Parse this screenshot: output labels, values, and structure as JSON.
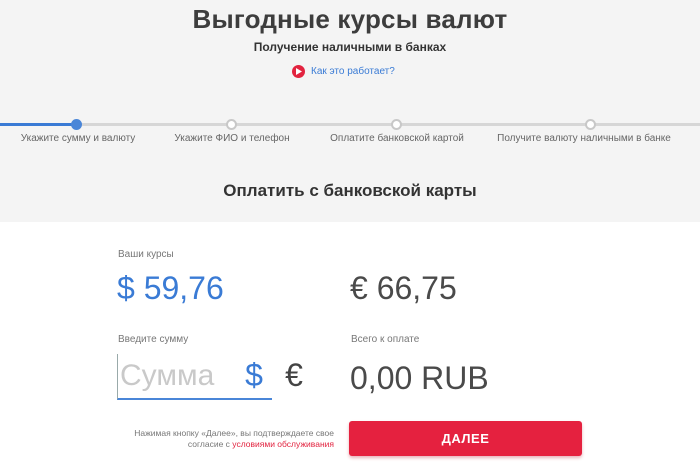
{
  "header": {
    "title": "Выгодные курсы валют",
    "subtitle": "Получение наличными в банках",
    "how_it_works": "Как это работает?"
  },
  "steps": [
    {
      "label": "Укажите сумму и валюту",
      "active": true
    },
    {
      "label": "Укажите ФИО и телефон",
      "active": false
    },
    {
      "label": "Оплатите банковской картой",
      "active": false
    },
    {
      "label": "Получите валюту наличными в банке",
      "active": false
    }
  ],
  "section_title": "Оплатить с банковской карты",
  "rates": {
    "label": "Ваши курсы",
    "usd": "$ 59,76",
    "eur": "€ 66,75"
  },
  "amount": {
    "label": "Введите сумму",
    "placeholder": "Сумма",
    "value": "",
    "currencies": [
      "$",
      "€"
    ],
    "selected_currency": "$"
  },
  "total": {
    "label": "Всего к оплате",
    "value": "0,00 RUB"
  },
  "consent": {
    "text": "Нажимая кнопку «Далее», вы подтверждаете свое согласие с",
    "link": "условиями обслуживания"
  },
  "next_button": "ДАЛЕЕ",
  "colors": {
    "accent_blue": "#3a7bd5",
    "accent_red": "#e5213f"
  }
}
